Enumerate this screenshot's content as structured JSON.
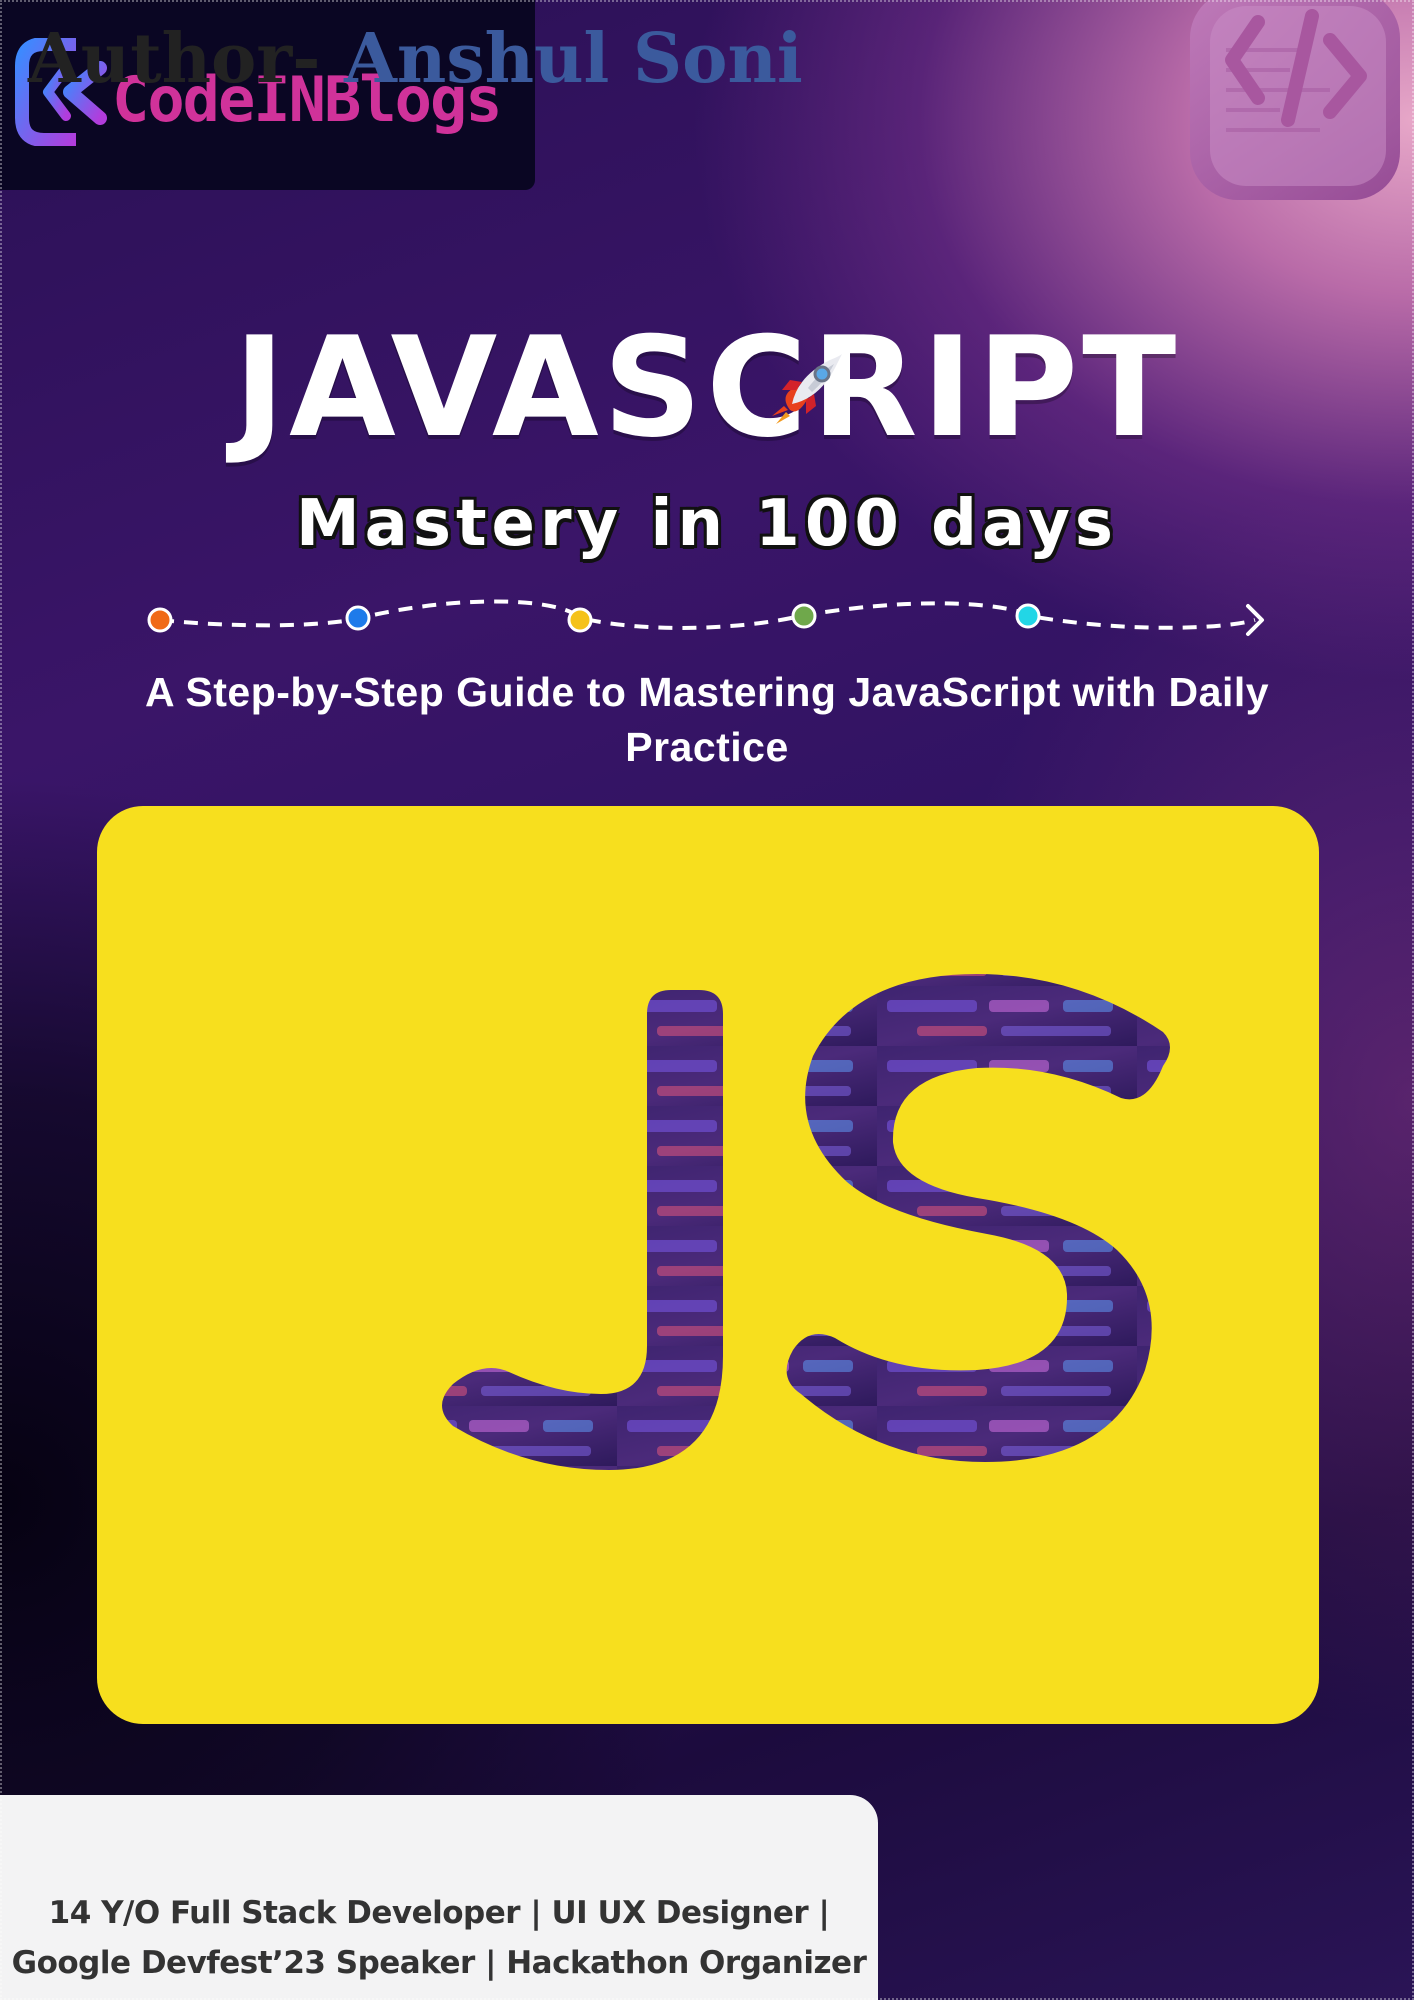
{
  "brand": {
    "name": "CodeINBlogs",
    "logo_icon": "codeinblogs-logo-icon",
    "colors": {
      "logo_gradient_start": "#3a7bff",
      "logo_gradient_end": "#d0329a"
    }
  },
  "cover": {
    "title": "JAVASCRIPT",
    "title_icon": "rocket-icon",
    "subtitle": "Mastery in 100 days",
    "tagline": "A Step-by-Step Guide to Mastering JavaScript with Daily Practice",
    "timeline_dots": [
      "#f06a17",
      "#1e7bea",
      "#f5c21a",
      "#6fa84b",
      "#22d6e6"
    ],
    "corner_icon": "code-tag-icon",
    "badge": {
      "text": "JS",
      "background": "#f7df1e"
    }
  },
  "author": {
    "prefix": "Author-",
    "name": "Anshul Soni",
    "bio_line1": "14 Y/O Full Stack Developer | UI UX Designer |",
    "bio_line2": "Google Devfest’23 Speaker | Hackathon Organizer"
  }
}
